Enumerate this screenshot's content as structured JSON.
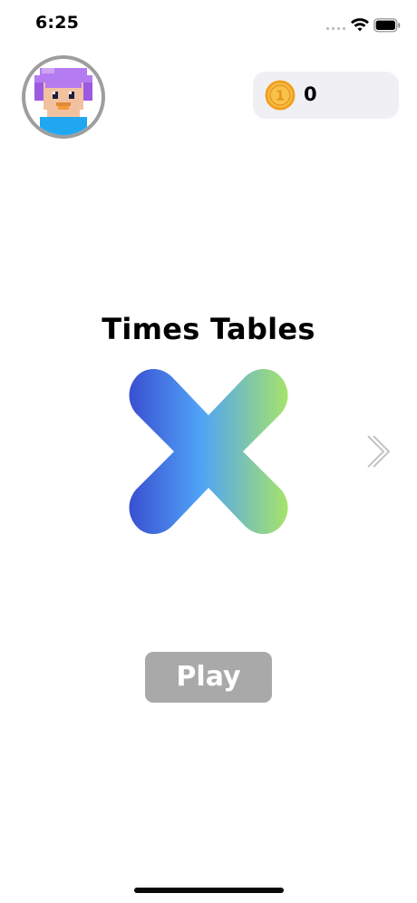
{
  "status_bar": {
    "time": "6:25",
    "icons": [
      "cellular-dots-icon",
      "wifi-icon",
      "battery-icon"
    ]
  },
  "profile": {
    "avatar": "pixel-character-avatar"
  },
  "coins": {
    "icon": "coin-icon",
    "coin_symbol": "1",
    "count": "0"
  },
  "game": {
    "title": "Times Tables",
    "logo": "multiply-x-icon",
    "next_icon": "chevron-right-icon",
    "play_label": "Play"
  },
  "colors": {
    "logo_gradient": [
      "#3f51d6",
      "#4fa3f7",
      "#a6e36b"
    ],
    "coin": "#f5a623",
    "play_button": "#a9a9a9",
    "pill_bg": "#f0f0f4",
    "avatar_hair": "#b57cf2",
    "avatar_shirt": "#1fa7f2"
  }
}
